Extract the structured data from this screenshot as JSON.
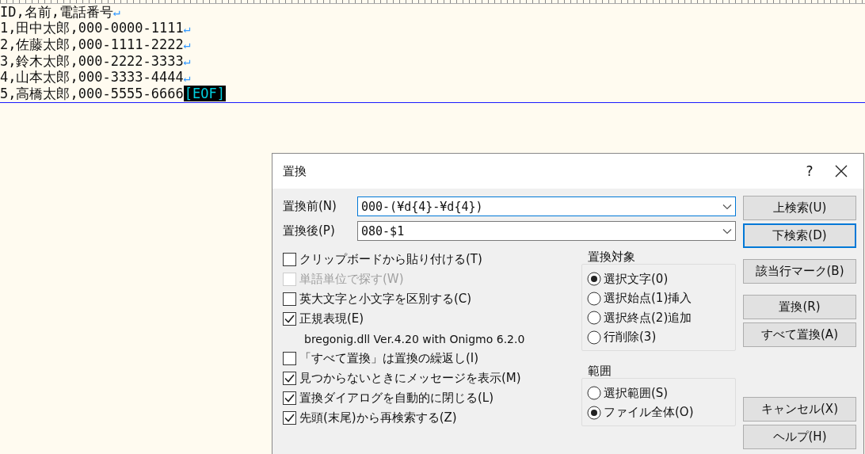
{
  "editor": {
    "lines": [
      {
        "text": "ID,名前,電話番号",
        "kind": "newline",
        "end_mark": "↵"
      },
      {
        "text": "1,田中太郎,000-0000-1111",
        "kind": "newline",
        "end_mark": "↵"
      },
      {
        "text": "2,佐藤太郎,000-1111-2222",
        "kind": "newline",
        "end_mark": "↵"
      },
      {
        "text": "3,鈴木太郎,000-2222-3333",
        "kind": "newline",
        "end_mark": "↵"
      },
      {
        "text": "4,山本太郎,000-3333-4444",
        "kind": "newline",
        "end_mark": "↵"
      },
      {
        "text": "5,高橋太郎,000-5555-6666",
        "kind": "eof",
        "end_mark": "[EOF]"
      }
    ]
  },
  "dialog": {
    "title": "置換",
    "help_glyph": "?",
    "fields": [
      {
        "label": "置換前(N)",
        "value": "000-(¥d{4}-¥d{4})",
        "focused": true
      },
      {
        "label": "置換後(P)",
        "value": "080-$1",
        "focused": false
      }
    ],
    "options": [
      {
        "kind": "checkbox",
        "label": "クリップボードから貼り付ける(T)",
        "checked": false,
        "disabled": false
      },
      {
        "kind": "checkbox",
        "label": "単語単位で探す(W)",
        "checked": false,
        "disabled": true
      },
      {
        "kind": "checkbox",
        "label": "英大文字と小文字を区別する(C)",
        "checked": false,
        "disabled": false
      },
      {
        "kind": "checkbox",
        "label": "正規表現(E)",
        "checked": true,
        "disabled": false
      },
      {
        "kind": "note",
        "label": "bregonig.dll Ver.4.20 with Onigmo 6.2.0"
      },
      {
        "kind": "checkbox",
        "label": "「すべて置換」は置換の繰返し(I)",
        "checked": false,
        "disabled": false
      },
      {
        "kind": "checkbox",
        "label": "見つからないときにメッセージを表示(M)",
        "checked": true,
        "disabled": false
      },
      {
        "kind": "checkbox",
        "label": "置換ダイアログを自動的に閉じる(L)",
        "checked": true,
        "disabled": false
      },
      {
        "kind": "checkbox",
        "label": "先頭(末尾)から再検索する(Z)",
        "checked": true,
        "disabled": false
      }
    ],
    "groups": [
      {
        "title": "置換対象",
        "radios": [
          {
            "label": "選択文字(0)",
            "selected": true
          },
          {
            "label": "選択始点(1)挿入",
            "selected": false
          },
          {
            "label": "選択終点(2)追加",
            "selected": false
          },
          {
            "label": "行削除(3)",
            "selected": false
          }
        ]
      },
      {
        "title": "範囲",
        "radios": [
          {
            "label": "選択範囲(S)",
            "selected": false
          },
          {
            "label": "ファイル全体(O)",
            "selected": true
          }
        ]
      }
    ],
    "button_groups": [
      [
        {
          "label": "上検索(U)",
          "default": false
        },
        {
          "label": "下検索(D)",
          "default": true
        }
      ],
      [
        {
          "label": "該当行マーク(B)",
          "default": false
        }
      ],
      [
        {
          "label": "置換(R)",
          "default": false
        },
        {
          "label": "すべて置換(A)",
          "default": false
        }
      ],
      [
        {
          "label": "キャンセル(X)",
          "default": false
        },
        {
          "label": "ヘルプ(H)",
          "default": false
        }
      ]
    ]
  }
}
